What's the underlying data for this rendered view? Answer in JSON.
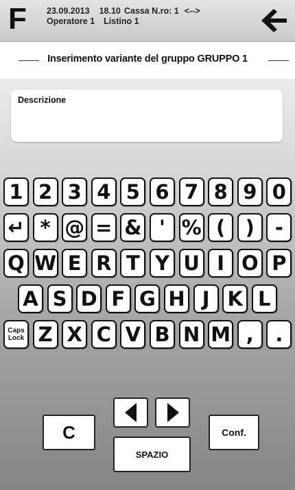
{
  "header": {
    "logo": "F",
    "date": "23.09.2013",
    "time": "18.10",
    "cassa": "Cassa N.ro: 1",
    "link": "<-->",
    "operator": "Operatore 1",
    "listino": "Listino 1"
  },
  "title": "Inserimento variante del gruppo GRUPPO 1",
  "description": {
    "label": "Descrizione",
    "value": ""
  },
  "keyboard": {
    "row1": [
      "1",
      "2",
      "3",
      "4",
      "5",
      "6",
      "7",
      "8",
      "9",
      "0"
    ],
    "row2": [
      "↵",
      "*",
      "@",
      "=",
      "&",
      "'",
      "%",
      "(",
      ")",
      "-"
    ],
    "row3": [
      "Q",
      "W",
      "E",
      "R",
      "T",
      "Y",
      "U",
      "I",
      "O",
      "P"
    ],
    "row4": [
      "A",
      "S",
      "D",
      "F",
      "G",
      "H",
      "J",
      "K",
      "L"
    ],
    "row5": [
      "Caps Lock",
      "Z",
      "X",
      "C",
      "V",
      "B",
      "N",
      "M",
      ",",
      "."
    ]
  },
  "buttons": {
    "clear": "C",
    "confirm": "Conf.",
    "space": "SPAZIO"
  },
  "icons": {
    "back": "left-arrow-icon",
    "left": "triangle-left-icon",
    "right": "triangle-right-icon"
  }
}
